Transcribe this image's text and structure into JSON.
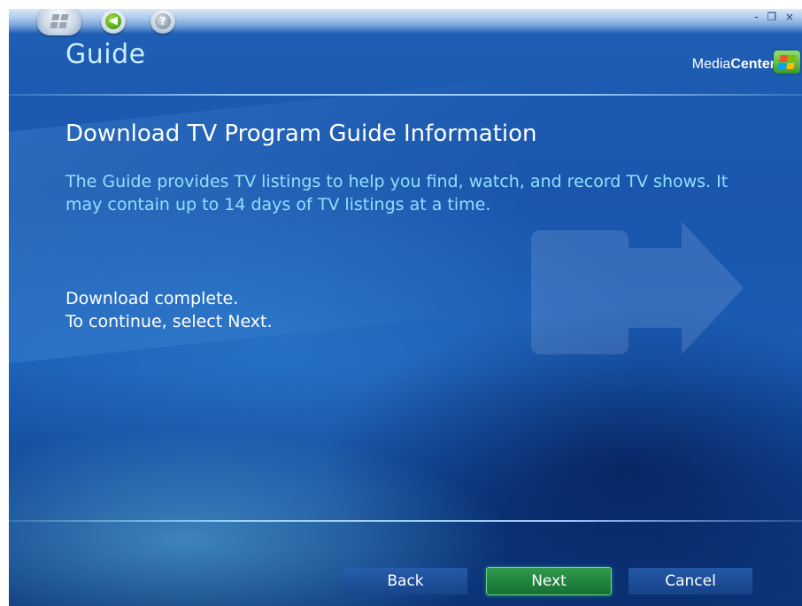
{
  "window": {
    "controls": "- ❐ ×"
  },
  "header": {
    "title": "Guide",
    "brand_prefix": "Media",
    "brand_bold": "Center"
  },
  "main": {
    "heading": "Download TV Program Guide Information",
    "description": "The Guide provides TV listings to help you find, watch, and record TV shows. It may contain up to 14 days of TV listings at a time.",
    "status_line1": "Download complete.",
    "status_line2": "To continue, select Next."
  },
  "buttons": {
    "back": "Back",
    "next": "Next",
    "cancel": "Cancel"
  },
  "icons": {
    "start": "windows-start-icon",
    "back": "back-arrow-icon",
    "help": "help-icon",
    "logo": "windows-flag-icon"
  }
}
